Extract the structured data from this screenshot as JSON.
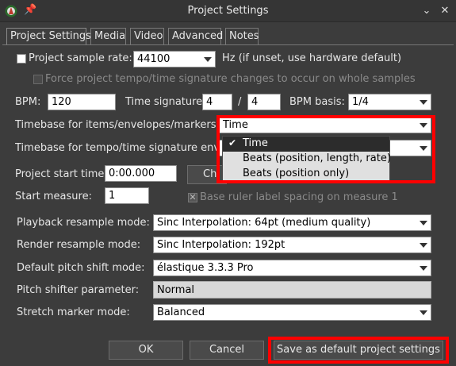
{
  "window": {
    "title": "Project Settings",
    "minimize_glyph": "⌄",
    "close_glyph": "✕"
  },
  "tabs": [
    "Project Settings",
    "Media",
    "Video",
    "Advanced",
    "Notes"
  ],
  "sample_rate": {
    "label": "Project sample rate:",
    "value": "44100",
    "hint": "Hz (if unset, use hardware default)"
  },
  "force_tempo": {
    "label": "Force project tempo/time signature changes to occur on whole samples"
  },
  "bpm": {
    "label": "BPM:",
    "value": "120"
  },
  "time_sig": {
    "label": "Time signature:",
    "num": "4",
    "sep": "/",
    "den": "4"
  },
  "bpm_basis": {
    "label": "BPM basis:",
    "value": "1/4"
  },
  "timebase_items": {
    "label": "Timebase for items/envelopes/markers:",
    "value": "Time"
  },
  "timebase_tempo": {
    "label": "Timebase for tempo/time signature envelope"
  },
  "dropdown": {
    "check": "✔",
    "options": [
      "Time",
      "Beats (position, length, rate)",
      "Beats (position only)"
    ]
  },
  "start_time": {
    "label": "Project start time:",
    "value": "0:00.000",
    "button": "Ch"
  },
  "start_measure": {
    "label": "Start measure:",
    "value": "1"
  },
  "base_ruler": {
    "label": "Base ruler label spacing on measure 1",
    "mark": "✕"
  },
  "playback_resample": {
    "label": "Playback resample mode:",
    "value": "Sinc Interpolation: 64pt (medium quality)"
  },
  "render_resample": {
    "label": "Render resample mode:",
    "value": "Sinc Interpolation: 192pt"
  },
  "pitch_shift": {
    "label": "Default pitch shift mode:",
    "value": "élastique 3.3.3 Pro"
  },
  "pitch_param": {
    "label": "Pitch shifter parameter:",
    "value": "Normal"
  },
  "stretch_marker": {
    "label": "Stretch marker mode:",
    "value": "Balanced"
  },
  "buttons": {
    "ok": "OK",
    "cancel": "Cancel",
    "save_default": "Save as default project settings"
  },
  "colors": {
    "highlight": "#ff0000",
    "background": "#3c3c3c"
  }
}
